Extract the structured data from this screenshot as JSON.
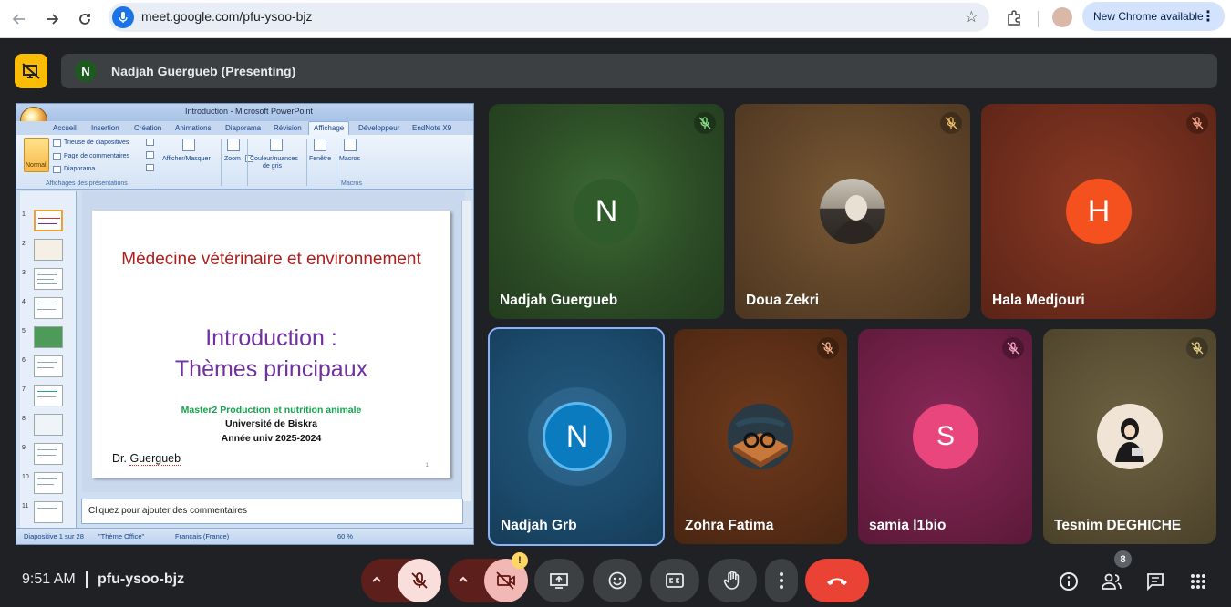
{
  "browser": {
    "url": "meet.google.com/pfu-ysoo-bjz",
    "update_label": "New Chrome available"
  },
  "presenting": {
    "avatar_letter": "N",
    "label": "Nadjah Guergueb (Presenting)"
  },
  "ppt": {
    "window_title": "Introduction - Microsoft PowerPoint",
    "tabs": [
      "Accueil",
      "Insertion",
      "Création",
      "Animations",
      "Diaporama",
      "Révision",
      "Affichage",
      "Développeur",
      "EndNote X9"
    ],
    "ribbon": {
      "normal": "Normal",
      "trieuse": "Trieuse de diapositives",
      "page_commentaires": "Page de commentaires",
      "diaporama": "Diaporama",
      "group_affichages": "Affichages des présentations",
      "afficher": "Afficher/Masquer",
      "zoom": "Zoom",
      "couleur": "Couleur/nuances",
      "couleur2": "de gris",
      "fenetre": "Fenêtre",
      "macros": "Macros",
      "group_macros": "Macros"
    },
    "thumb_numbers": [
      "1",
      "2",
      "3",
      "4",
      "5",
      "6",
      "7",
      "8",
      "9",
      "10",
      "11"
    ],
    "slide": {
      "title": "Médecine vétérinaire et environnement",
      "heading1": "Introduction :",
      "heading2": "Thèmes principaux",
      "line_master": "Master2 Production et nutrition animale",
      "line_univ": "Université de Biskra",
      "line_annee": "Année univ 2025-2024",
      "author_prefix": "Dr. ",
      "author_name": "Guergueb",
      "number": "1"
    },
    "notes_placeholder": "Cliquez pour ajouter des commentaires",
    "status": {
      "slide": "Diapositive 1 sur 28",
      "theme": "\"Thème Office\"",
      "lang": "Français (France)",
      "zoom": "60 %"
    }
  },
  "participants": [
    {
      "name": "Nadjah Guergueb",
      "letter": "N",
      "muted": true
    },
    {
      "name": "Doua Zekri",
      "letter": "",
      "muted": true
    },
    {
      "name": "Hala Medjouri",
      "letter": "H",
      "muted": true
    },
    {
      "name": "Nadjah Grb",
      "letter": "N",
      "muted": false
    },
    {
      "name": "Zohra Fatima",
      "letter": "",
      "muted": true
    },
    {
      "name": "samia l1bio",
      "letter": "S",
      "muted": true
    },
    {
      "name": "Tesnim DEGHICHE",
      "letter": "",
      "muted": true
    }
  ],
  "bottom": {
    "time": "9:51 AM",
    "code": "pfu-ysoo-bjz",
    "people_count": "8",
    "camera_warning": "!"
  },
  "colors": {
    "meet_bg": "#202124",
    "presenting_yellow": "#fbbc04",
    "end_call_red": "#ea4335",
    "mic_off_pink": "#f9dedc",
    "tile_green": "#2b4a25",
    "tile_brown": "#5e4328",
    "tile_rust": "#6e2c1c",
    "tile_blue": "#1b4a6b",
    "tile_magenta": "#6e1f45",
    "tile_olive": "#5a4f34"
  }
}
